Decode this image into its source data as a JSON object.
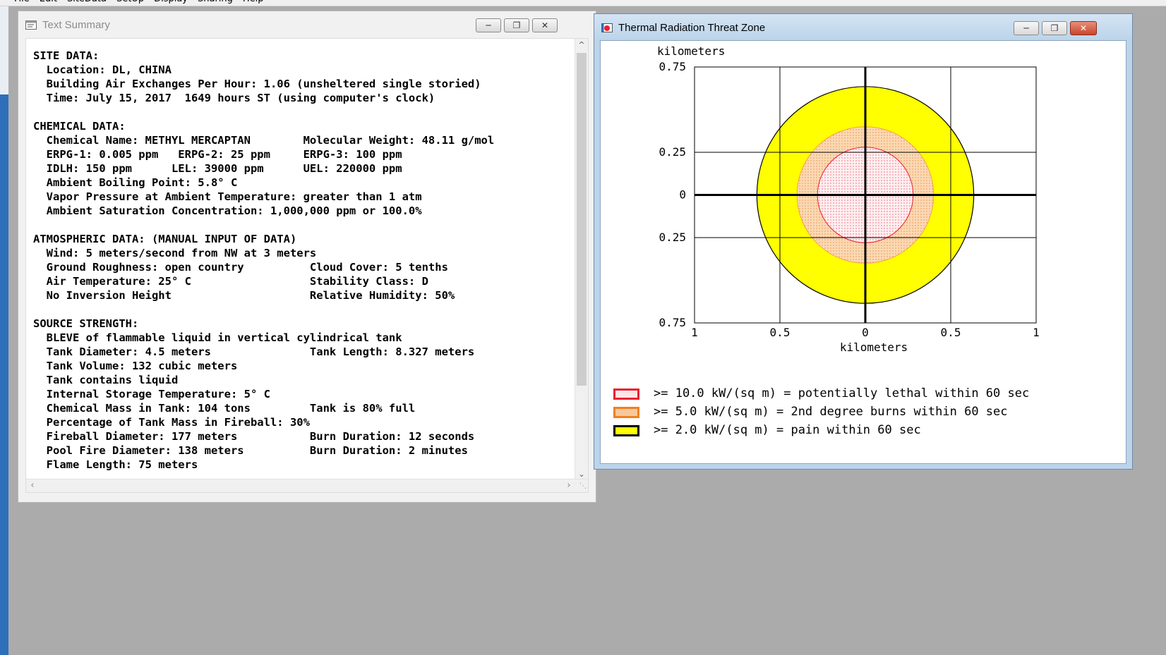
{
  "menubar": {
    "items": [
      "File",
      "Edit",
      "SiteData",
      "SetUp",
      "Display",
      "Sharing",
      "Help"
    ]
  },
  "text_window": {
    "title": "Text Summary",
    "lines": [
      "SITE DATA:",
      "  Location: DL, CHINA",
      "  Building Air Exchanges Per Hour: 1.06 (unsheltered single storied)",
      "  Time: July 15, 2017  1649 hours ST (using computer's clock)",
      "",
      "CHEMICAL DATA:",
      "  Chemical Name: METHYL MERCAPTAN        Molecular Weight: 48.11 g/mol",
      "  ERPG-1: 0.005 ppm   ERPG-2: 25 ppm     ERPG-3: 100 ppm",
      "  IDLH: 150 ppm      LEL: 39000 ppm      UEL: 220000 ppm",
      "  Ambient Boiling Point: 5.8° C",
      "  Vapor Pressure at Ambient Temperature: greater than 1 atm",
      "  Ambient Saturation Concentration: 1,000,000 ppm or 100.0%",
      "",
      "ATMOSPHERIC DATA: (MANUAL INPUT OF DATA)",
      "  Wind: 5 meters/second from NW at 3 meters",
      "  Ground Roughness: open country          Cloud Cover: 5 tenths",
      "  Air Temperature: 25° C                  Stability Class: D",
      "  No Inversion Height                     Relative Humidity: 50%",
      "",
      "SOURCE STRENGTH:",
      "  BLEVE of flammable liquid in vertical cylindrical tank",
      "  Tank Diameter: 4.5 meters               Tank Length: 8.327 meters",
      "  Tank Volume: 132 cubic meters",
      "  Tank contains liquid",
      "  Internal Storage Temperature: 5° C",
      "  Chemical Mass in Tank: 104 tons         Tank is 80% full",
      "  Percentage of Tank Mass in Fireball: 30%",
      "  Fireball Diameter: 177 meters           Burn Duration: 12 seconds",
      "  Pool Fire Diameter: 138 meters          Burn Duration: 2 minutes",
      "  Flame Length: 75 meters"
    ]
  },
  "plot_window": {
    "title": "Thermal Radiation Threat Zone",
    "plot": {
      "y_unit": "kilometers",
      "x_unit": "kilometers",
      "y_ticks": [
        {
          "value": 0.75,
          "label": "0.75"
        },
        {
          "value": 0.25,
          "label": "0.25"
        },
        {
          "value": 0,
          "label": "0"
        },
        {
          "value": -0.25,
          "label": "0.25"
        },
        {
          "value": -0.75,
          "label": "0.75"
        }
      ],
      "x_ticks": [
        {
          "value": -1,
          "label": "1"
        },
        {
          "value": -0.5,
          "label": "0.5"
        },
        {
          "value": 0,
          "label": "0"
        },
        {
          "value": 0.5,
          "label": "0.5"
        },
        {
          "value": 1,
          "label": "1"
        }
      ],
      "x_range": [
        -1,
        1
      ],
      "y_range": [
        -0.75,
        0.75
      ],
      "zones": [
        {
          "name": "yellow",
          "radius_km": 0.635,
          "fill": "#ffff00",
          "stroke": "#000000"
        },
        {
          "name": "orange",
          "radius_km": 0.4,
          "fill": "#fbd9b4",
          "stroke": "#f6a04a"
        },
        {
          "name": "red",
          "radius_km": 0.28,
          "fill": "#fde7ea",
          "stroke": "#e8202f"
        }
      ]
    },
    "legend": [
      {
        "text": ">= 10.0 kW/(sq m) = potentially lethal within 60 sec",
        "border": "#e8202f",
        "fill": "#fde4e6"
      },
      {
        "text": ">= 5.0 kW/(sq m) = 2nd degree burns within 60 sec",
        "border": "#f08020",
        "fill": "#f8c89a"
      },
      {
        "text": ">= 2.0 kW/(sq m) = pain within 60 sec",
        "border": "#000000",
        "fill": "#ffff00"
      }
    ]
  }
}
